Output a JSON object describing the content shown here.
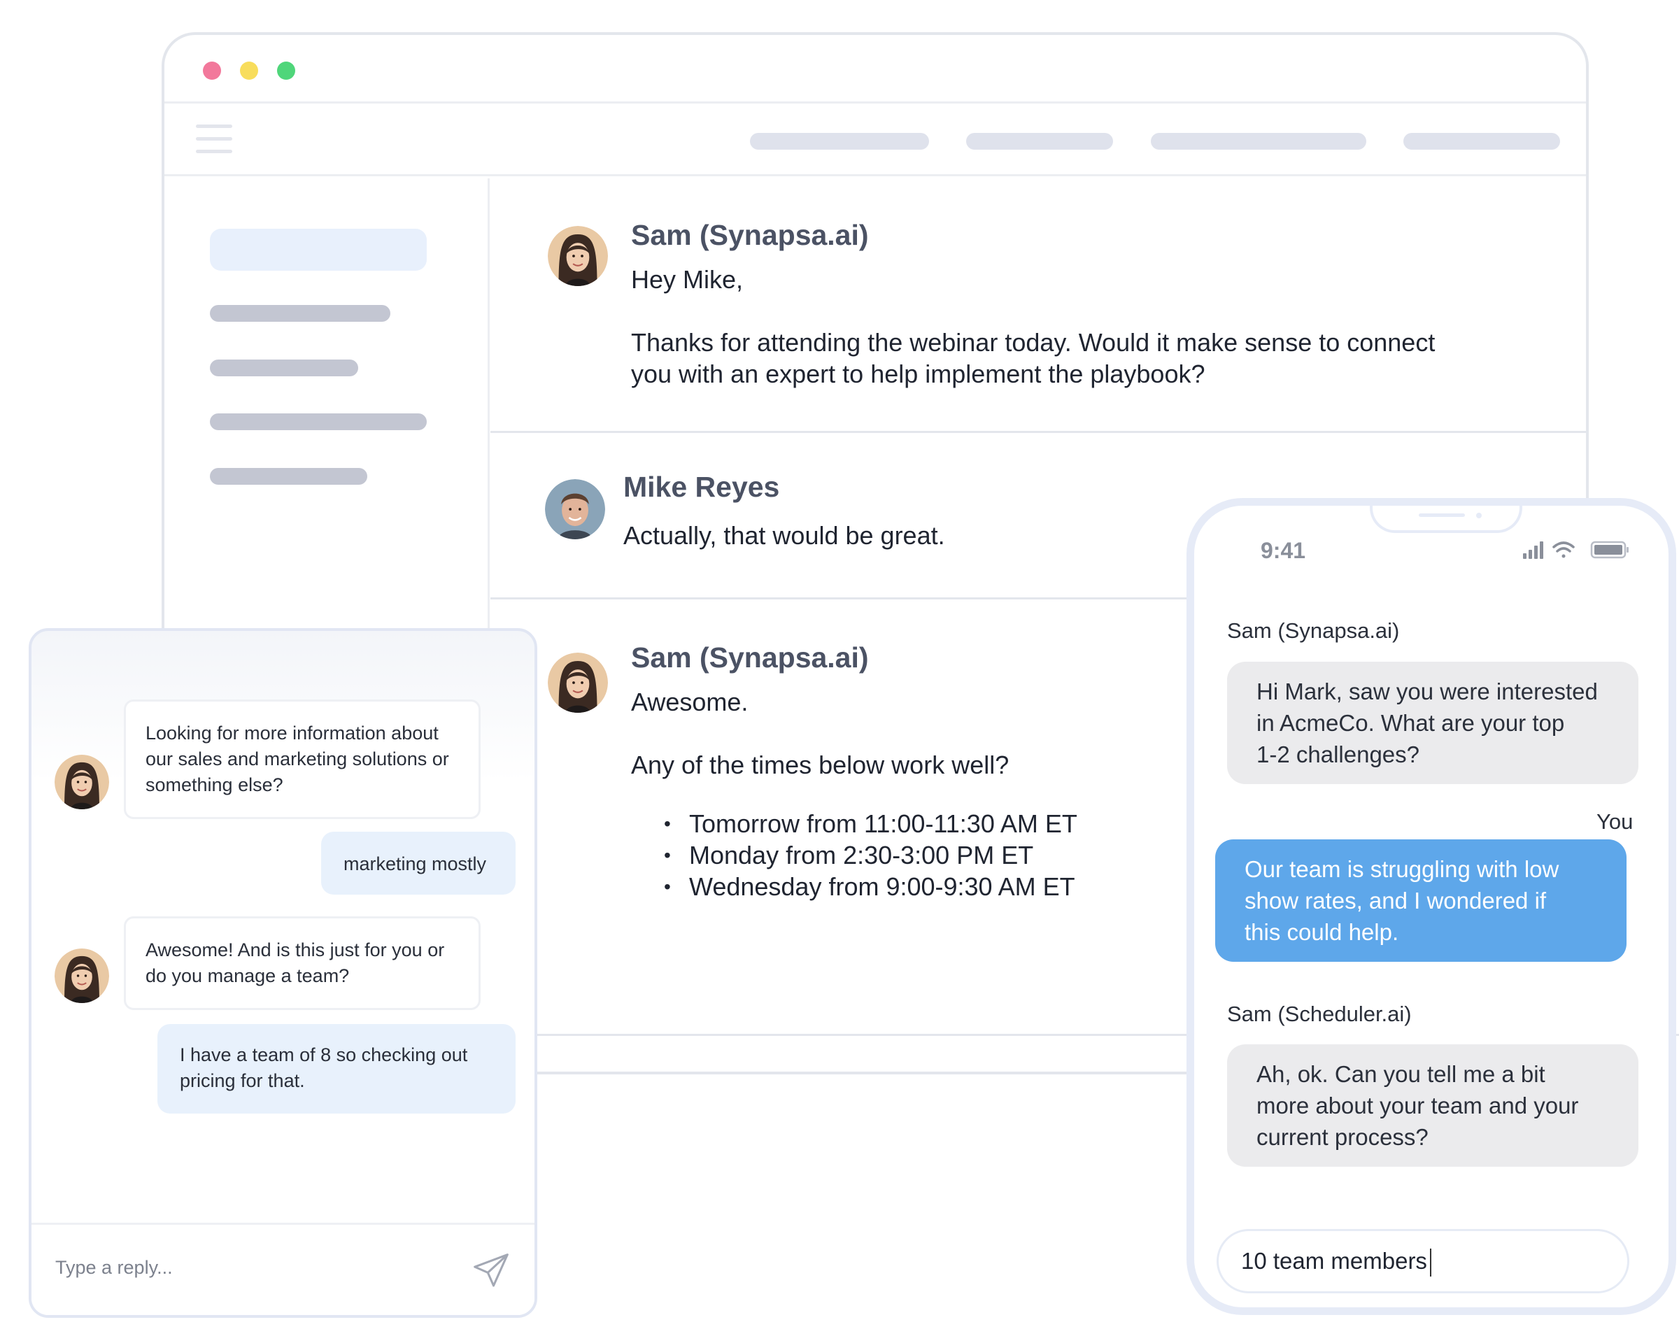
{
  "browser": {
    "messages": [
      {
        "sender": "Sam (Synapsa.ai)",
        "text": "Hey Mike,\n\nThanks for attending the webinar today.  Would it make sense to connect\nyou with an expert to help implement the playbook?"
      },
      {
        "sender": "Mike Reyes",
        "text": "Actually, that would be great."
      },
      {
        "sender": "Sam (Synapsa.ai)",
        "text": "Awesome.\n\nAny of the times below work well?",
        "times": [
          "Tomorrow from 11:00-11:30 AM ET",
          "Monday from 2:30-3:00 PM ET",
          "Wednesday from 9:00-9:30 AM ET"
        ]
      }
    ]
  },
  "widget": {
    "messages": [
      {
        "from": "bot",
        "text": "Looking for more information about\nour sales and marketing solutions or\nsomething else?"
      },
      {
        "from": "user",
        "text": "marketing mostly"
      },
      {
        "from": "bot",
        "text": "Awesome! And is this just for you or\ndo you manage a team?"
      },
      {
        "from": "user",
        "text": "I have a team of 8 so checking out\npricing for that."
      }
    ],
    "input_placeholder": "Type a reply...",
    "send_icon": "paper-plane-icon"
  },
  "phone": {
    "status_time": "9:41",
    "status_icons": [
      "signal-icon",
      "wifi-icon",
      "battery-icon"
    ],
    "sender1": "Sam (Synapsa.ai)",
    "msg1": "Hi Mark, saw you were interested\nin AcmeCo. What are your top\n1-2 challenges?",
    "you_label": "You",
    "msg2": "Our team is struggling with low\nshow rates, and I wondered if\nthis could help.",
    "sender2": "Sam (Scheduler.ai)",
    "msg3": "Ah, ok. Can you tell me a bit\nmore about your team and your\ncurrent process?",
    "input_value": "10 team members"
  },
  "colors": {
    "accent_blue": "#5ea7ea",
    "light_blue": "#e8f1fc",
    "dot_red": "#f2789b",
    "dot_yellow": "#f8dd5c",
    "dot_green": "#4fd67a"
  }
}
